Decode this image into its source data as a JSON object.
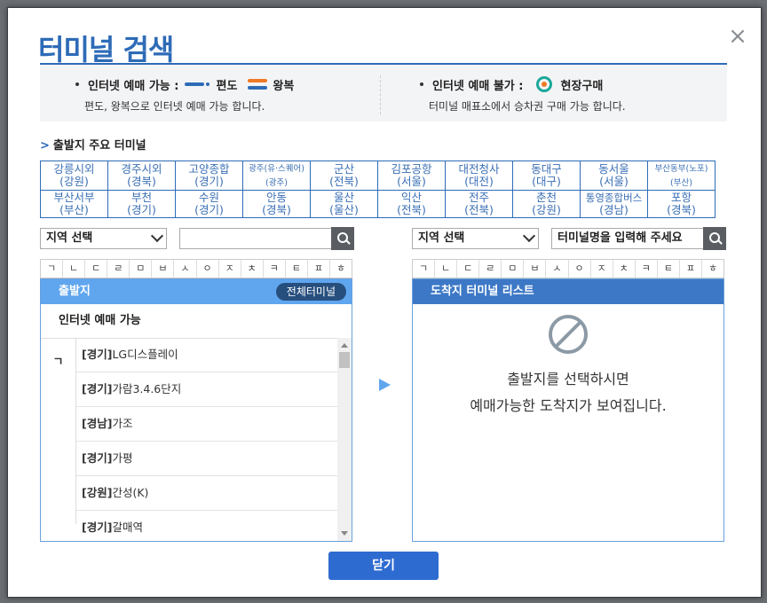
{
  "title": "터미널 검색",
  "close_symbol": "×",
  "info": {
    "available_label": "인터넷 예매 가능 :",
    "oneway_label": "편도",
    "round_label": "왕복",
    "available_desc": "편도, 왕복으로 인터넷 예매 가능 합니다.",
    "unavailable_label": "인터넷 예매 불가 :",
    "onsite_label": "현장구매",
    "unavailable_desc": "터미널 매표소에서 승차권 구매 가능 합니다."
  },
  "major_heading": "출발지 주요 터미널",
  "major_terminals": [
    [
      {
        "name": "강릉시외",
        "region": "(강원)"
      },
      {
        "name": "경주시외",
        "region": "(경북)"
      },
      {
        "name": "고양종합",
        "region": "(경기)"
      },
      {
        "name": "광주(유·스퀘어)",
        "region": "(광주)"
      },
      {
        "name": "군산",
        "region": "(전북)"
      },
      {
        "name": "김포공항",
        "region": "(서울)"
      },
      {
        "name": "대전청사",
        "region": "(대전)"
      },
      {
        "name": "동대구",
        "region": "(대구)"
      },
      {
        "name": "동서울",
        "region": "(서울)"
      },
      {
        "name": "부산동부(노포)",
        "region": "(부산)"
      }
    ],
    [
      {
        "name": "부산서부",
        "region": "(부산)"
      },
      {
        "name": "부천",
        "region": "(경기)"
      },
      {
        "name": "수원",
        "region": "(경기)"
      },
      {
        "name": "안동",
        "region": "(경북)"
      },
      {
        "name": "울산",
        "region": "(울산)"
      },
      {
        "name": "익산",
        "region": "(전북)"
      },
      {
        "name": "전주",
        "region": "(전북)"
      },
      {
        "name": "춘천",
        "region": "(강원)"
      },
      {
        "name": "통영종합버스",
        "region": "(경남)"
      },
      {
        "name": "포항",
        "region": "(경북)"
      }
    ]
  ],
  "departure": {
    "region_select": "지역 선택",
    "search_value": "",
    "consonants": [
      "ㄱ",
      "ㄴ",
      "ㄷ",
      "ㄹ",
      "ㅁ",
      "ㅂ",
      "ㅅ",
      "ㅇ",
      "ㅈ",
      "ㅊ",
      "ㅋ",
      "ㅌ",
      "ㅍ",
      "ㅎ"
    ],
    "header": "출발지",
    "all_button": "전체터미널",
    "subheader": "인터넷 예매 가능",
    "initial": "ㄱ",
    "items": [
      {
        "region": "[경기]",
        "name": "LG디스플레이"
      },
      {
        "region": "[경기]",
        "name": "가람3.4.6단지"
      },
      {
        "region": "[경남]",
        "name": "가조"
      },
      {
        "region": "[경기]",
        "name": "가평"
      },
      {
        "region": "[강원]",
        "name": "간성(K)"
      },
      {
        "region": "[경기]",
        "name": "갈매역"
      }
    ]
  },
  "arrival": {
    "region_select": "지역 선택",
    "search_value": "터미널명을 입력해 주세요",
    "consonants": [
      "ㄱ",
      "ㄴ",
      "ㄷ",
      "ㄹ",
      "ㅁ",
      "ㅂ",
      "ㅅ",
      "ㅇ",
      "ㅈ",
      "ㅊ",
      "ㅋ",
      "ㅌ",
      "ㅍ",
      "ㅎ"
    ],
    "header": "도착지 터미널 리스트",
    "empty_line1": "출발지를 선택하시면",
    "empty_line2": "예매가능한 도착지가 보여집니다."
  },
  "close_button": "닫기"
}
